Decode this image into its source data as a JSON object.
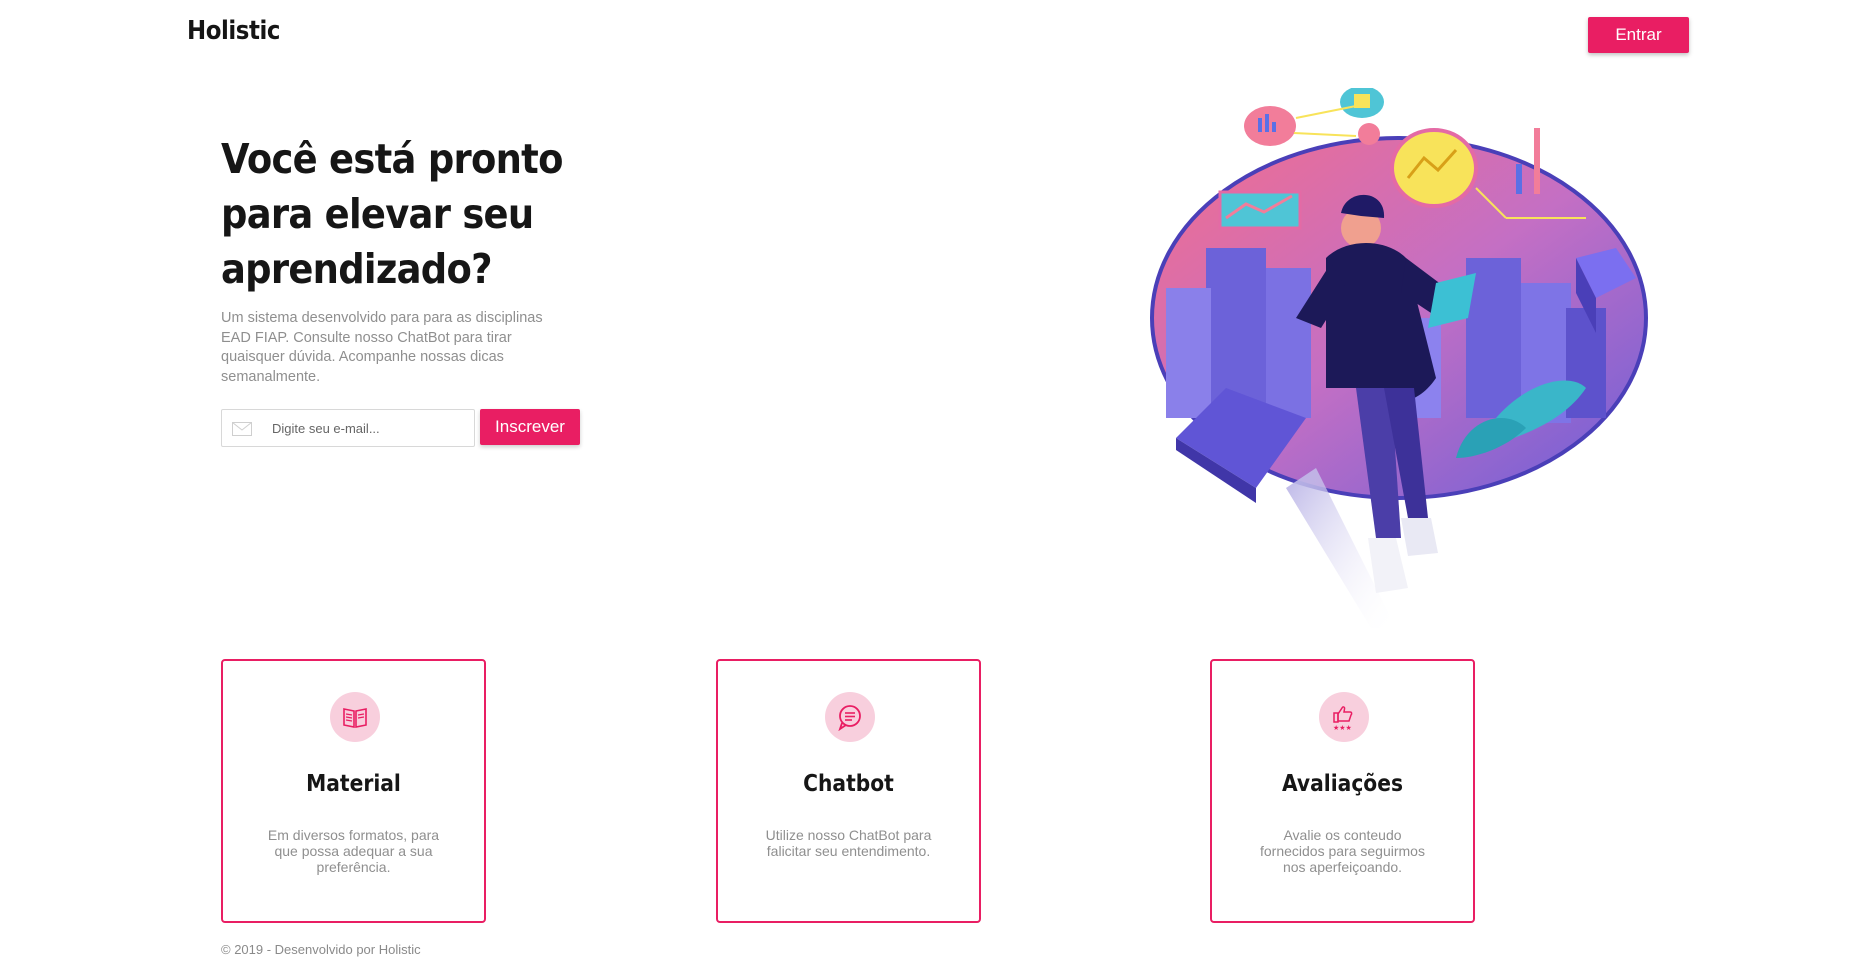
{
  "header": {
    "brand": "Holistic",
    "login_label": "Entrar"
  },
  "hero": {
    "title": "Você está pronto para elevar seu aprendizado?",
    "description": "Um sistema desenvolvido para para as disciplinas EAD FIAP. Consulte nosso ChatBot para tirar quaisquer dúvida. Acompanhe nossas dicas semanalmente.",
    "email_placeholder": "Digite seu e-mail...",
    "email_value": "",
    "subscribe_label": "Inscrever"
  },
  "features": [
    {
      "title": "Material",
      "text": "Em diversos formatos, para que possa adequar a sua preferência.",
      "icon": "book-icon"
    },
    {
      "title": "Chatbot",
      "text": "Utilize nosso ChatBot para falicitar seu entendimento.",
      "icon": "chat-icon"
    },
    {
      "title": "Avaliações",
      "text": "Avalie os conteudo fornecidos para seguirmos nos aperfeiçoando.",
      "icon": "rating-icon"
    }
  ],
  "footer": {
    "text": "© 2019 - Desenvolvido por Holistic"
  },
  "colors": {
    "accent": "#e91e63",
    "icon_bg": "#f8cfdd",
    "muted_text": "#8f8f8f"
  }
}
